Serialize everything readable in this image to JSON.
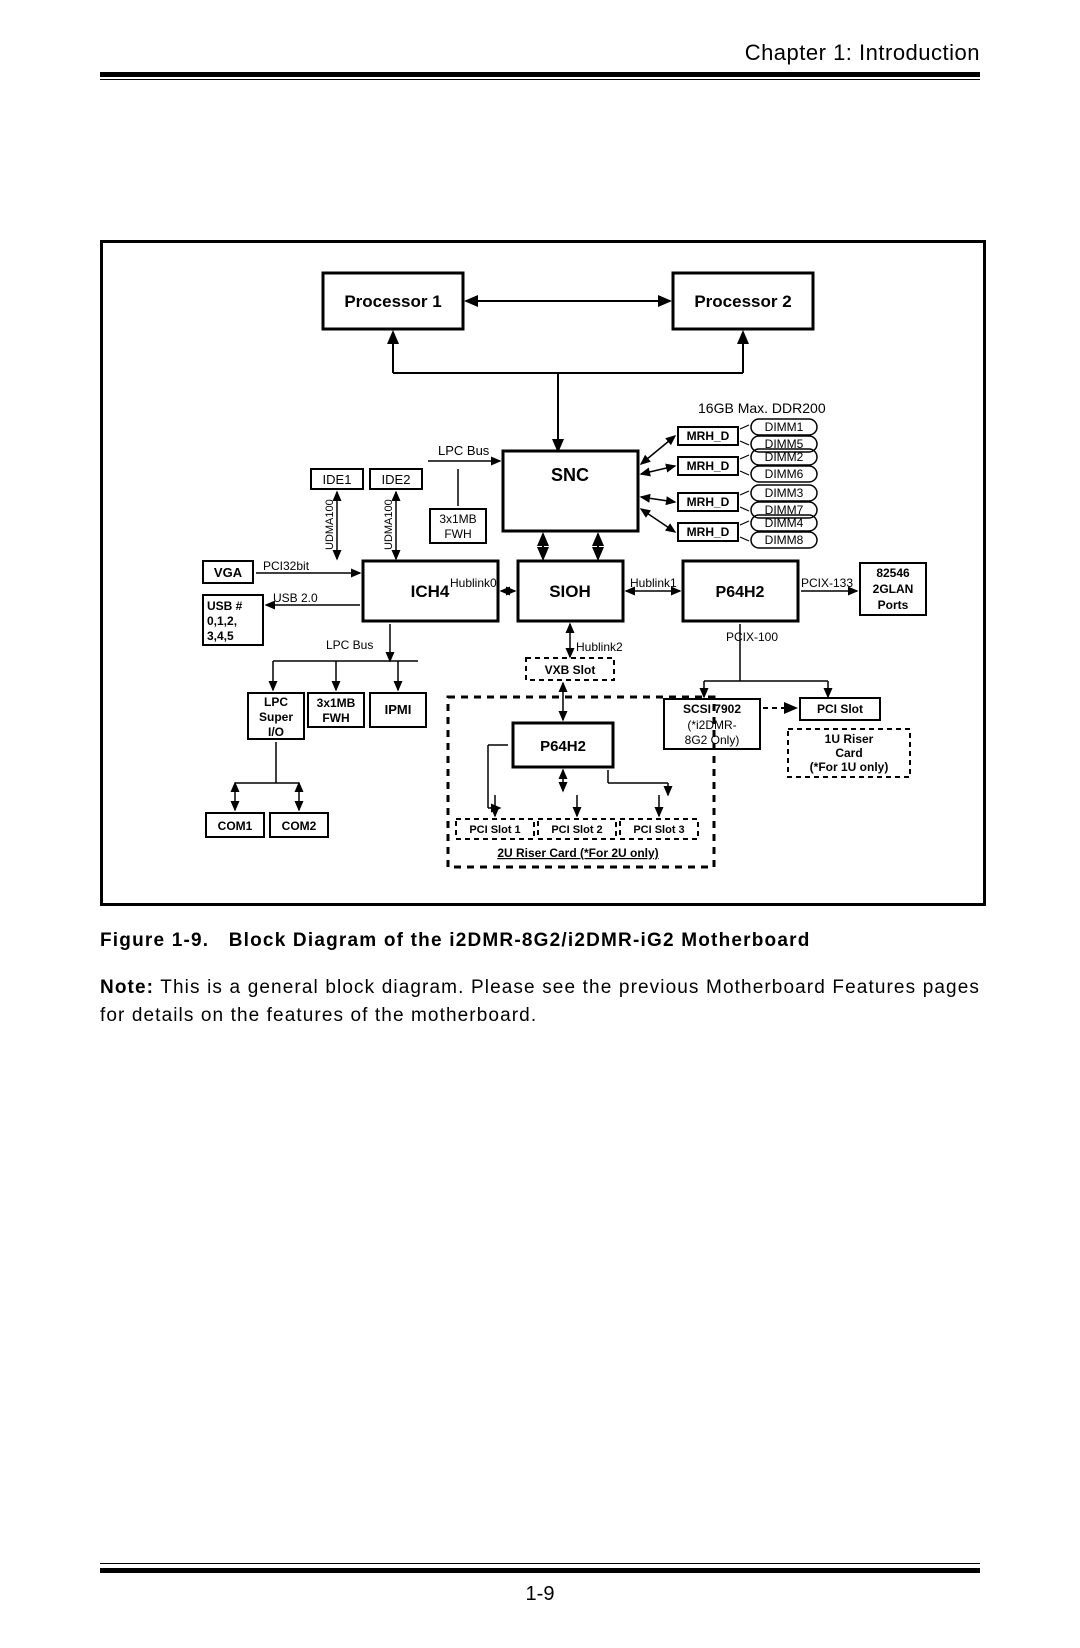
{
  "header": {
    "chapter": "Chapter 1: Introduction"
  },
  "figure": {
    "caption_prefix": "Figure 1-9.",
    "caption_text": "Block Diagram of the i2DMR-8G2/i2DMR-iG2 Motherboard"
  },
  "note": {
    "prefix": "Note:",
    "text": "This is a general block diagram.  Please see the previous Motherboard Features pages for details on the features of the motherboard."
  },
  "footer": {
    "page_number": "1-9"
  },
  "diagram": {
    "blocks": {
      "proc1": "Processor 1",
      "proc2": "Processor 2",
      "snc": "SNC",
      "sioh": "SIOH",
      "ich4": "ICH4",
      "p64h2_right": "P64H2",
      "p64h2_bottom": "P64H2",
      "vga": "VGA",
      "usb_label1": "USB #",
      "usb_label2": "0,1,2,",
      "usb_label3": "3,4,5",
      "lpc_super1": "LPC",
      "lpc_super2": "Super",
      "lpc_super3": "I/O",
      "fwh_small1": "3x1MB",
      "fwh_small2": "FWH",
      "ipmi": "IPMI",
      "com1": "COM1",
      "com2": "COM2",
      "ide1": "IDE1",
      "ide2": "IDE2",
      "fwh_block1": "3x1MB",
      "fwh_block2": "FWH",
      "vxb_slot": "VXB Slot",
      "pci_slot1": "PCI Slot 1",
      "pci_slot2": "PCI Slot 2",
      "pci_slot3": "PCI Slot 3",
      "riser_2u": "2U Riser Card  (*For 2U only)",
      "scsi1": "SCSI 7902",
      "scsi2": "(*i2DMR-",
      "scsi3": "8G2 Only)",
      "pci_slot_r": "PCI Slot",
      "riser_1u1": "1U Riser",
      "riser_1u2": "Card",
      "riser_1u3": "(*For 1U only)",
      "glan1": "82546",
      "glan2": "2GLAN",
      "glan3": "Ports",
      "mrh_d": "MRH_D",
      "dimm1": "DIMM1",
      "dimm5": "DIMM5",
      "dimm2": "DIMM2",
      "dimm6": "DIMM6",
      "dimm3": "DIMM3",
      "dimm7": "DIMM7",
      "dimm4": "DIMM4",
      "dimm8": "DIMM8"
    },
    "links": {
      "lpc_bus_top": "LPC Bus",
      "lpc_bus_bottom": "LPC Bus",
      "hublink0": "Hublink0",
      "hublink1": "Hublink1",
      "hublink2": "Hublink2",
      "pci32bit": "PCI32bit",
      "usb20": "USB 2.0",
      "pcix133": "PCIX-133",
      "pcix100": "PCIX-100",
      "udma100a": "UDMA100",
      "udma100b": "UDMA100",
      "ddr": "16GB Max. DDR200"
    }
  }
}
